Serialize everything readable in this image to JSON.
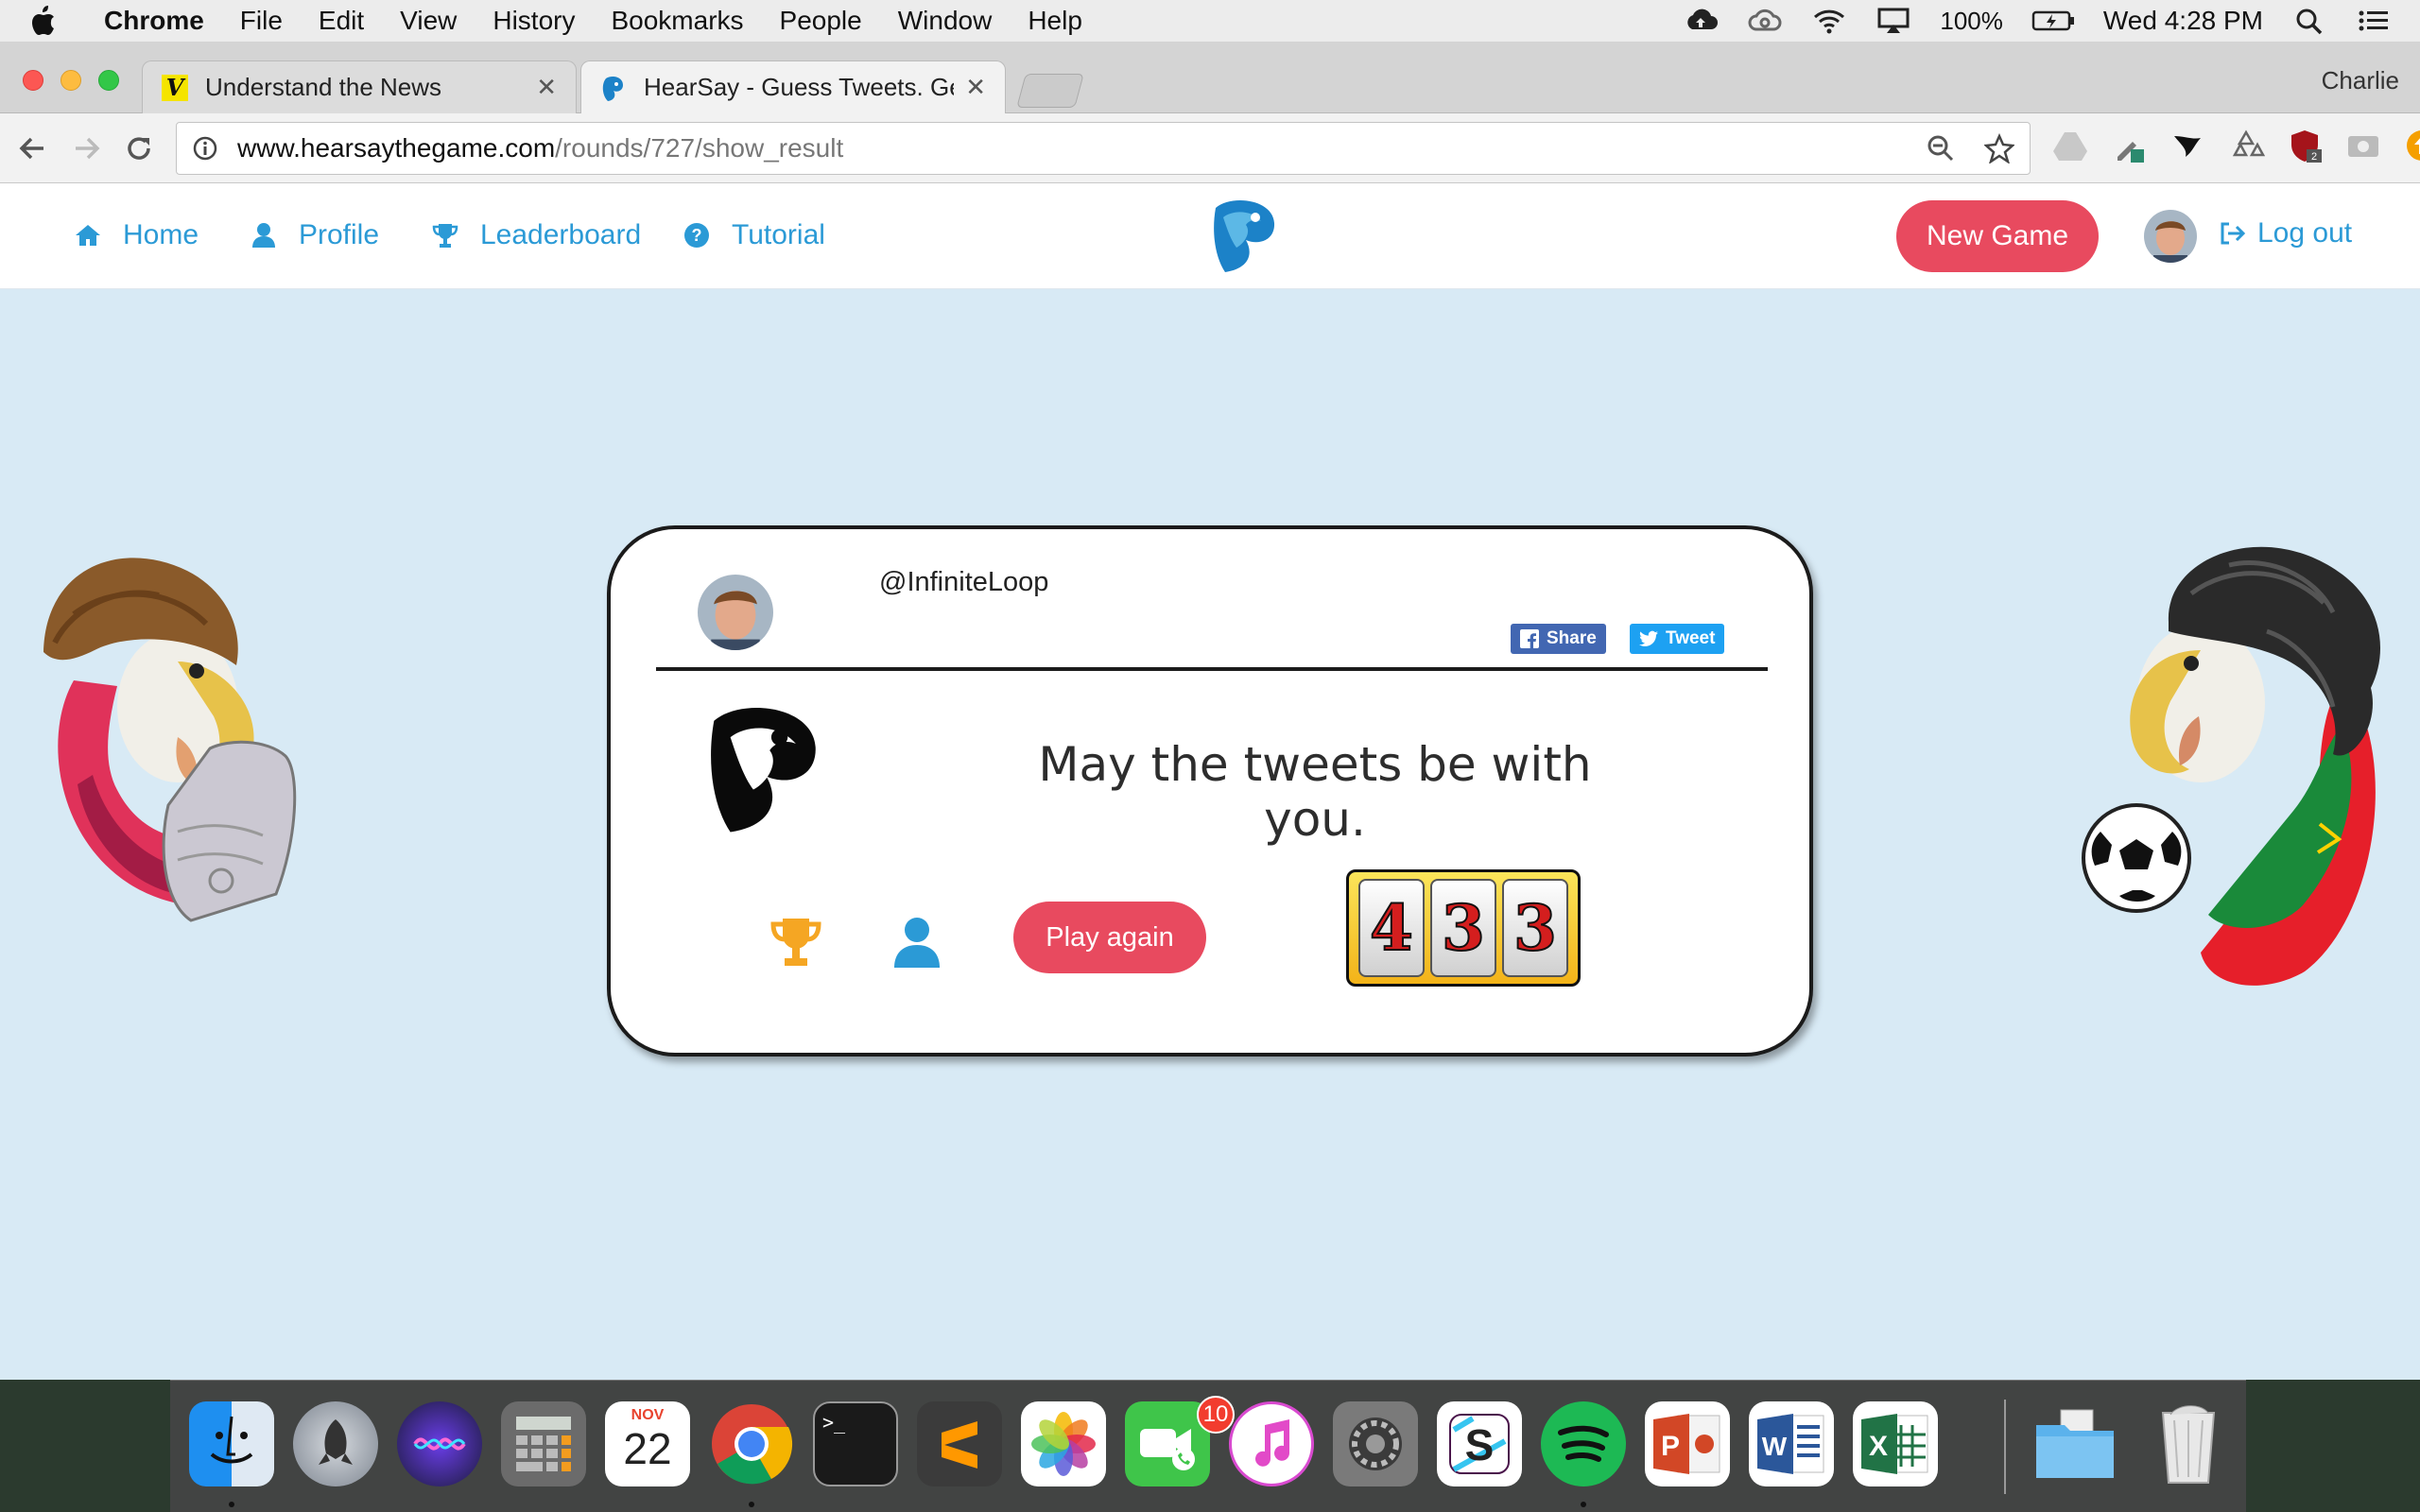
{
  "menubar": {
    "app_name": "Chrome",
    "items": [
      "File",
      "Edit",
      "View",
      "History",
      "Bookmarks",
      "People",
      "Window",
      "Help"
    ],
    "battery": "100%",
    "clock": "Wed 4:28 PM",
    "status_icons": [
      "cloud-upload-icon",
      "creative-cloud-icon",
      "wifi-icon",
      "airplay-icon",
      "battery-icon",
      "spotlight-search-icon",
      "notification-center-icon"
    ]
  },
  "browser": {
    "tabs": [
      {
        "title": "Understand the News",
        "favicon": "v-logo-icon",
        "active": false
      },
      {
        "title": "HearSay - Guess Tweets. Get F",
        "favicon": "hearsay-logo-icon",
        "active": true
      }
    ],
    "profile": "Charlie",
    "url_host": "www.hearsaythegame.com",
    "url_path": "/rounds/727/show_result"
  },
  "site": {
    "nav": {
      "home": "Home",
      "profile": "Profile",
      "leaderboard": "Leaderboard",
      "tutorial": "Tutorial",
      "new_game": "New Game",
      "logout": "Log out"
    },
    "colors": {
      "accent": "#2b9ad6",
      "button": "#e84a5f",
      "background": "#d8eaf5"
    }
  },
  "result": {
    "username": "@InfiniteLoop",
    "share_label": "Share",
    "tweet_label": "Tweet",
    "message": "May the tweets be with you.",
    "play_again": "Play again",
    "score_digits": [
      "4",
      "3",
      "3"
    ]
  },
  "dock": {
    "apps": [
      "finder",
      "launchpad",
      "siri",
      "calculator",
      "calendar",
      "chrome",
      "terminal",
      "sublime-text",
      "photos",
      "facetime",
      "itunes",
      "system-preferences",
      "slack",
      "spotify",
      "powerpoint",
      "word",
      "excel",
      "downloads",
      "trash"
    ],
    "calendar_month": "NOV",
    "calendar_day": "22",
    "facetime_badge": "10"
  }
}
